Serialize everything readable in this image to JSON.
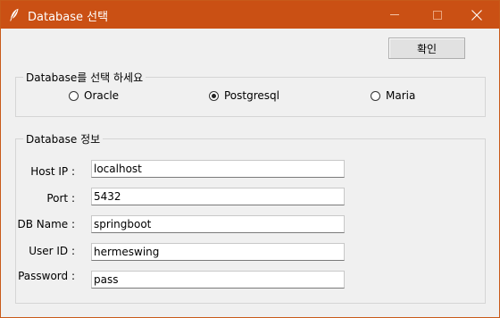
{
  "window": {
    "title": "Database 선택",
    "titlebar_color": "#ca5014",
    "controls": [
      "minimize-icon",
      "maximize-icon",
      "close-icon"
    ]
  },
  "toolbar": {
    "confirm_label": "확인"
  },
  "db_select": {
    "legend": "Database를 선택 하세요",
    "options": [
      {
        "label": "Oracle",
        "selected": false
      },
      {
        "label": "Postgresql",
        "selected": true
      },
      {
        "label": "Maria",
        "selected": false
      }
    ]
  },
  "db_info": {
    "legend": "Database 정보",
    "fields": [
      {
        "label": "Host IP :",
        "value": "localhost"
      },
      {
        "label": "Port :",
        "value": "5432"
      },
      {
        "label": "DB Name :",
        "value": "springboot"
      },
      {
        "label": "User ID :",
        "value": "hermeswing"
      },
      {
        "label": "Password :",
        "value": "pass"
      }
    ]
  }
}
